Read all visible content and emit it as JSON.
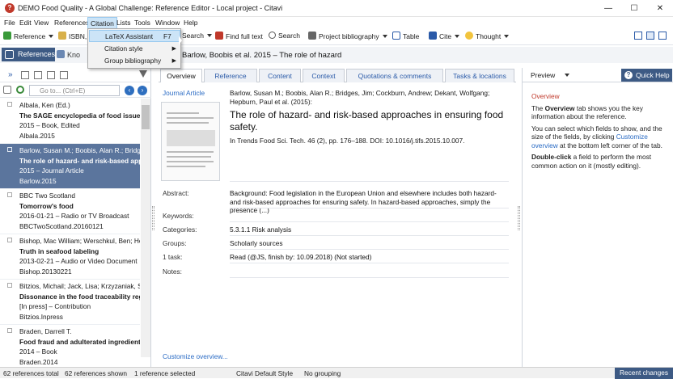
{
  "window": {
    "title": "DEMO Food Quality - A Global Challenge: Reference Editor - Local project - Citavi",
    "app_icon_glyph": "?",
    "minimize_glyph": "—",
    "maximize_glyph": "☐",
    "close_glyph": "✕"
  },
  "menu": [
    "File",
    "Edit",
    "View",
    "References",
    "Citation",
    "Lists",
    "Tools",
    "Window",
    "Help"
  ],
  "toolbar": {
    "reference": "Reference",
    "isbn": "ISBN,",
    "search_partial": "Search",
    "find_full_text": "Find full text",
    "search": "Search",
    "project_bibliography": "Project bibliography",
    "table": "Table",
    "cite": "Cite",
    "thought": "Thought"
  },
  "dropdown": {
    "items": [
      {
        "label": "LaTeX Assistant",
        "shortcut": "F7"
      },
      {
        "label": "Citation style",
        "shortcut": ""
      },
      {
        "label": "Group bibliography",
        "shortcut": ""
      }
    ]
  },
  "navbar": {
    "references": "References",
    "knowledge_partial": "Kno",
    "selected_title": "Barlow, Boobis et al. 2015 – The role of hazard"
  },
  "left": {
    "search_placeholder": "Go to... (Ctrl+E)",
    "references": [
      {
        "authors": "Albala, Ken (Ed.)",
        "title": "The SAGE encyclopedia of food issues",
        "meta": "2015 – Book, Edited",
        "key": "Albala.2015",
        "selected": false
      },
      {
        "authors": "Barlow, Susan M.; Boobis, Alan R.; Bridges, J",
        "title": "The role of hazard- and risk-based approaches",
        "meta": "2015 – Journal Article",
        "key": "Barlow.2015",
        "selected": true
      },
      {
        "authors": "BBC Two Scotland",
        "title": "Tomorrow's food",
        "meta": "2016-01-21 – Radio or TV Broadcast",
        "key": "BBCTwoScotland.20160121",
        "selected": false
      },
      {
        "authors": "Bishop, Mac William; Werschkul, Ben; Hod",
        "title": "Truth in seafood labeling",
        "meta": "2013-02-21 – Audio or Video Document",
        "key": "Bishop.20130221",
        "selected": false
      },
      {
        "authors": "Bitzios, Michail; Jack, Lisa; Krzyzaniak, Sally",
        "title": "Dissonance in the food traceability regula",
        "meta": "[In press] – Contribution",
        "key": "Bitzios.Inpress",
        "selected": false
      },
      {
        "authors": "Braden, Darrell T.",
        "title": "Food fraud and adulterated ingredients.",
        "meta": "2014 – Book",
        "key": "Braden.2014",
        "selected": false
      }
    ]
  },
  "tabs": [
    "Overview",
    "Reference",
    "Content",
    "Context",
    "Quotations & comments",
    "Tasks & locations"
  ],
  "center": {
    "type": "Journal Article",
    "authors_line": "Barlow, Susan M.; Boobis, Alan R.; Bridges, Jim; Cockburn, Andrew; Dekant, Wolfgang; Hepburn, Paul et al. (2015):",
    "title": "The role of hazard- and risk-based approaches in ensuring food safety.",
    "citation": "In Trends Food Sci. Tech. 46 (2), pp. 176–188. DOI: 10.1016/j.tifs.2015.10.007.",
    "abstract_label": "Abstract:",
    "abstract": "Background: Food legislation in the European Union and elsewhere includes both hazard- and risk-based approaches for ensuring safety. In hazard-based approaches, simply the presence (...)",
    "keywords_label": "Keywords:",
    "categories_label": "Categories:",
    "categories": "5.3.1.1 Risk analysis",
    "groups_label": "Groups:",
    "groups": "Scholarly sources",
    "task_label": "1 task:",
    "task": "Read (@JS, finish by: 10.09.2018) (Not started)",
    "notes_label": "Notes:",
    "customize": "Customize overview..."
  },
  "right": {
    "preview": "Preview",
    "quick_help": "Quick Help",
    "heading": "Overview",
    "p1_pre": "The ",
    "p1_bold": "Overview",
    "p1_post": " tab shows you the key information about the reference.",
    "p2_pre": "You can select which fields to show, and the size of the fields, by clicking ",
    "p2_link": "Customize overview",
    "p2_post": " at the bottom left corner of the tab.",
    "p3_bold": "Double-click",
    "p3_post": " a field to perform the most common action on it (mostly editing)."
  },
  "status": {
    "total": "62 references total",
    "shown": "62 references shown",
    "selected": "1 reference selected",
    "style": "Citavi Default Style",
    "grouping": "No grouping",
    "recent": "Recent changes"
  },
  "colors": {
    "accent": "#3d5a84",
    "selection": "#5b759d",
    "link": "#2a6bc4",
    "help_heading": "#c0392b"
  }
}
